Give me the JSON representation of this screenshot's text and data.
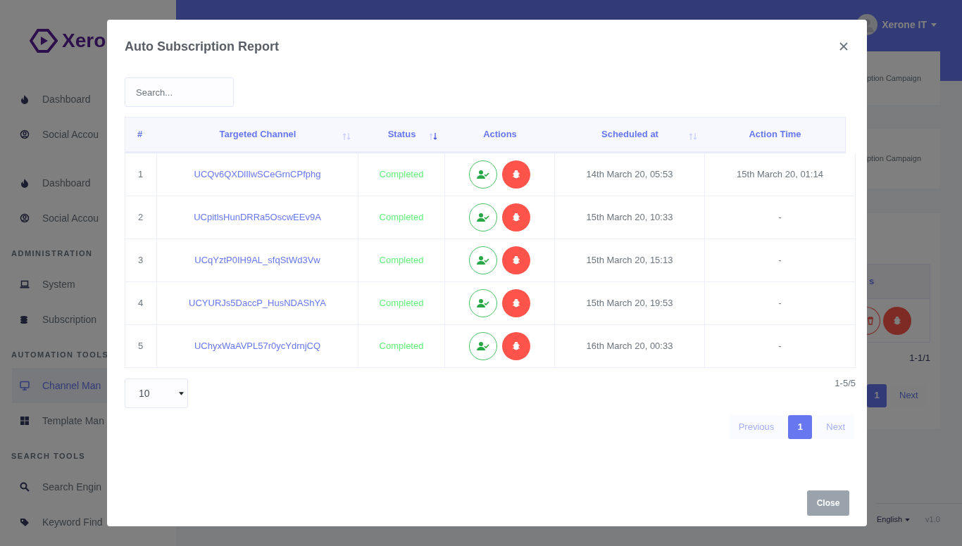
{
  "background": {
    "logo": "Xero",
    "sidebar": [
      {
        "items": [
          {
            "label": "Dashboard",
            "selected": false
          },
          {
            "label": "Social Accou",
            "selected": false
          }
        ]
      },
      {
        "items": [
          {
            "label": "Dashboard",
            "selected": false
          },
          {
            "label": "Social Accou",
            "selected": false
          }
        ]
      },
      {
        "header": "ADMINISTRATION",
        "items": [
          {
            "label": "System",
            "selected": false
          },
          {
            "label": "Subscription",
            "selected": false
          }
        ]
      },
      {
        "header": "AUTOMATION TOOLS",
        "items": [
          {
            "label": "Channel Man",
            "selected": true
          },
          {
            "label": "Template Man",
            "selected": false
          }
        ]
      },
      {
        "header": "SEARCH TOOLS",
        "items": [
          {
            "label": "Search Engin",
            "selected": false
          },
          {
            "label": "Keyword Find",
            "selected": false
          }
        ]
      }
    ],
    "user": "Xerone IT",
    "cards": [
      "ption Campaign",
      "ption Campaign"
    ],
    "table_card": {
      "header": "s",
      "count": "1-1/1",
      "pages": [
        {
          "label": "1",
          "selected": true
        },
        {
          "label": "Next",
          "selected": false
        }
      ]
    },
    "footer": {
      "language": "English",
      "version": "v1.0"
    }
  },
  "modal": {
    "title": "Auto Subscription Report",
    "search": {
      "placeholder": "Search..."
    },
    "columns": [
      {
        "label": "#"
      },
      {
        "label": "Targeted Channel",
        "sorted": false
      },
      {
        "label": "Status",
        "sorted": true
      },
      {
        "label": "Actions"
      },
      {
        "label": "Scheduled at",
        "sorted": false
      },
      {
        "label": "Action Time"
      }
    ],
    "rows": [
      {
        "number": "1",
        "channel": "UCQv6QXDlIlwSCeGrnCPfphg",
        "status": "Completed",
        "scheduled": "14th March 20, 05:53",
        "action_time": "15th March 20, 01:14"
      },
      {
        "number": "2",
        "channel": "UCpitlsHunDRRa5OscwEEv9A",
        "status": "Completed",
        "scheduled": "15th March 20, 10:33",
        "action_time": "-"
      },
      {
        "number": "3",
        "channel": "UCqYztP0IH9AL_sfqStWd3Vw",
        "status": "Completed",
        "scheduled": "15th March 20, 15:13",
        "action_time": "-"
      },
      {
        "number": "4",
        "channel": "UCYURJs5DaccP_HusNDAShYA",
        "status": "Completed",
        "scheduled": "15th March 20, 19:53",
        "action_time": "-"
      },
      {
        "number": "5",
        "channel": "UChyxWaAVPL57r0ycYdrnjCQ",
        "status": "Completed",
        "scheduled": "16th March 20, 00:33",
        "action_time": "-"
      }
    ],
    "page_size": "10",
    "range": "1-5/5",
    "pagination": [
      {
        "label": "Previous",
        "selected": false
      },
      {
        "label": "1",
        "selected": true
      },
      {
        "label": "Next",
        "selected": false
      }
    ],
    "close_button": "Close"
  }
}
